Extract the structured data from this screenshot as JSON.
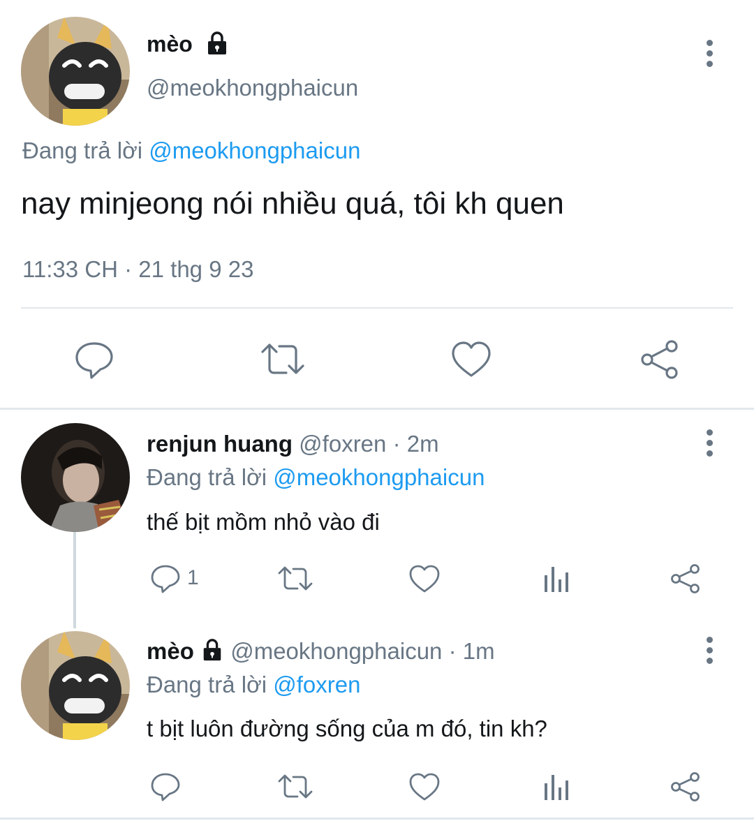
{
  "main_tweet": {
    "display_name": "mèo",
    "handle": "@meokhongphaicun",
    "reply_prefix": "Đang trả lời",
    "reply_to": "@meokhongphaicun",
    "text": "nay minjeong nói nhiều quá, tôi kh quen",
    "timestamp": "11:33 CH · 21 thg 9 23"
  },
  "replies": [
    {
      "display_name": "renjun huang",
      "handle": "@foxren",
      "time": "· 2m",
      "reply_prefix": "Đang trả lời",
      "reply_to": "@meokhongphaicun",
      "text": "thế bịt mồm nhỏ vào đi",
      "reply_count": "1"
    },
    {
      "display_name": "mèo",
      "handle": "@meokhongphaicun",
      "time": "· 1m",
      "reply_prefix": "Đang trả lời",
      "reply_to": "@foxren",
      "text": "t bịt luôn đường sống của m đó, tin kh?",
      "reply_count": ""
    }
  ],
  "colors": {
    "link": "#1d9bf0",
    "secondary_text": "#687684",
    "divider": "#e1e8ed"
  },
  "icons": [
    "lock-icon",
    "more-icon",
    "reply-icon",
    "retweet-icon",
    "like-icon",
    "share-icon",
    "analytics-icon"
  ]
}
